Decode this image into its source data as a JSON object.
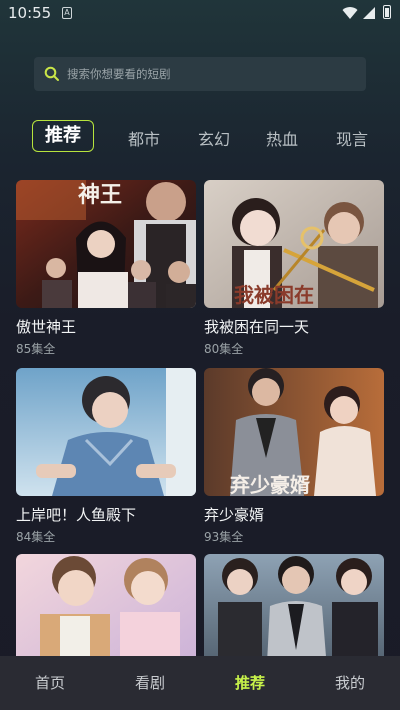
{
  "status_bar": {
    "time": "10:55",
    "sim_label": "A"
  },
  "search": {
    "placeholder": "搜索你想要看的短剧"
  },
  "tabs": [
    {
      "label": "推荐",
      "active": true
    },
    {
      "label": "都市"
    },
    {
      "label": "玄幻"
    },
    {
      "label": "热血"
    },
    {
      "label": "现言"
    }
  ],
  "cards": [
    {
      "title": "傲世神王",
      "episodes": "85集全",
      "poster_text": "神王"
    },
    {
      "title": "我被困在同一天",
      "episodes": "80集全",
      "poster_text": "我被困在"
    },
    {
      "title": "上岸吧！人鱼殿下",
      "episodes": "84集全"
    },
    {
      "title": "弃少豪婿",
      "episodes": "93集全",
      "poster_text": "弃少豪婿"
    },
    {
      "title": "",
      "episodes": ""
    },
    {
      "title": "",
      "episodes": ""
    }
  ],
  "bottom_nav": [
    {
      "label": "首页"
    },
    {
      "label": "看剧"
    },
    {
      "label": "推荐",
      "active": true
    },
    {
      "label": "我的"
    }
  ],
  "colors": {
    "accent": "#b7e43d",
    "nav_active": "#c7f24a",
    "background": "#1a1b27"
  }
}
